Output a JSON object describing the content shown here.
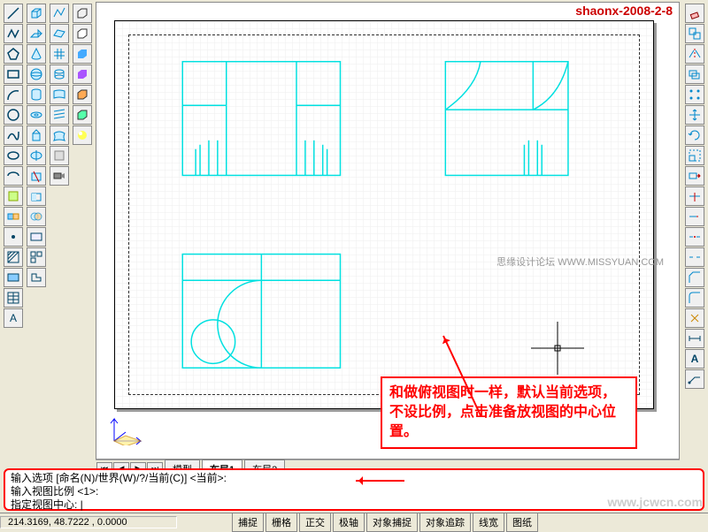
{
  "watermarks": {
    "top": "shaonx-2008-2-8",
    "mid": "思缘设计论坛  WWW.MISSYUAN.COM",
    "bottom": "www.jcwcn.com"
  },
  "tabs": {
    "first": "⏮",
    "prev": "◀",
    "next": "▶",
    "last": "⏭",
    "model": "模型",
    "layout1": "布局1",
    "layout2": "布局2"
  },
  "command": {
    "line1": "输入选项 [命名(N)/世界(W)/?/当前(C)] <当前>:",
    "line2": "输入视图比例 <1>:",
    "line3": "指定视图中心: "
  },
  "status": {
    "coords": "214.3169, 48.7222 , 0.0000",
    "buttons": [
      "捕捉",
      "栅格",
      "正交",
      "极轴",
      "对象捕捉",
      "对象追踪",
      "线宽",
      "图纸"
    ]
  },
  "annotation": "和做俯视图时一样，默认当前选项，不设比例，点击准备放视图的中心位置。",
  "left_tools": {
    "col1": [
      "line",
      "polyline",
      "polygon",
      "rect",
      "arc",
      "circle",
      "spline",
      "ellipse",
      "ellipse-arc",
      "insert",
      "block",
      "point",
      "hatch",
      "region",
      "table",
      "mtext"
    ],
    "col2": [
      "box",
      "wedge",
      "cone",
      "sphere",
      "cylinder",
      "torus",
      "extrude",
      "revolve",
      "slice",
      "section",
      "interfere",
      "setup-draw",
      "setup-view",
      "setup-profile"
    ],
    "col3": [
      "3dpoly",
      "3dface",
      "mesh",
      "revsurf",
      "tabsurf",
      "rulesurf",
      "edgesurf",
      "3dmesh",
      "3dsolid"
    ],
    "col4": [
      "hide",
      "shade-flat",
      "shade-gouraud",
      "shade-flat-edge",
      "shade-gouraud-edge",
      "render",
      "setup"
    ]
  },
  "right_tools": [
    "erase",
    "copy",
    "mirror",
    "offset",
    "array",
    "move",
    "rotate",
    "scale",
    "stretch",
    "trim",
    "extend",
    "break-point",
    "break",
    "chamfer",
    "fillet",
    "explode",
    "dim",
    "leader",
    "text-edit"
  ]
}
